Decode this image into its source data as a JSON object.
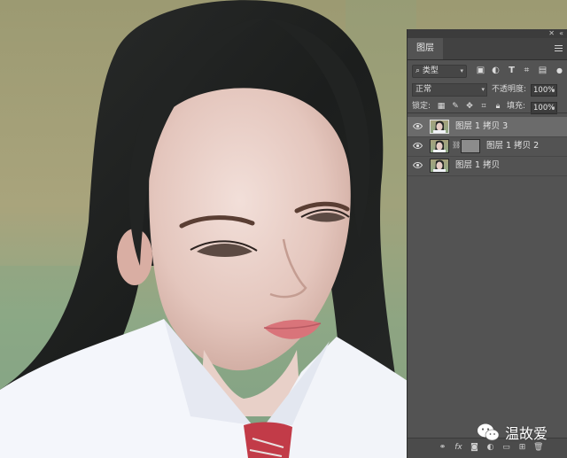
{
  "panel": {
    "tab_label": "图层",
    "filter_label": "类型",
    "blend_mode": "正常",
    "opacity_label": "不透明度:",
    "opacity_value": "100%",
    "lock_label": "锁定:",
    "fill_label": "填充:",
    "fill_value": "100%",
    "layers": [
      {
        "name": "图层 1 拷贝 3",
        "selected": true,
        "has_mask": false
      },
      {
        "name": "图层 1 拷贝 2",
        "selected": false,
        "has_mask": true
      },
      {
        "name": "图层 1 拷贝",
        "selected": false,
        "has_mask": false
      }
    ],
    "footer_fx": "fx"
  },
  "watermark": {
    "text": "温故爱"
  },
  "colors": {
    "panel_bg": "#535353",
    "selected_row": "#6b6b6b",
    "tab_bar": "#424242"
  }
}
